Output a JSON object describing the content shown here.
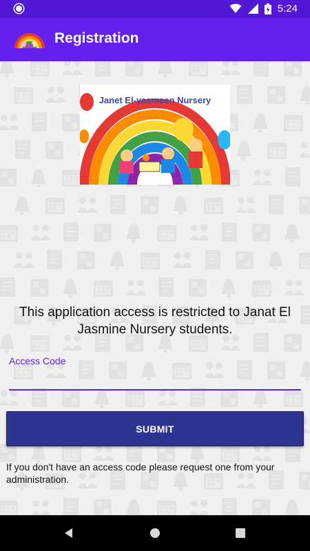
{
  "status_bar": {
    "time": "5:24",
    "icons": [
      "notification-dot-icon",
      "wifi-icon",
      "signal-icon",
      "battery-charging-icon"
    ]
  },
  "app_bar": {
    "title": "Registration",
    "logo_icon": "rainbow-logo-icon"
  },
  "hero": {
    "banner_text": "Janet El-yasmeen Nursery"
  },
  "message": "This application access is restricted to Janat El Jasmine Nursery students.",
  "access_code": {
    "label": "Access Code",
    "value": "",
    "placeholder": ""
  },
  "submit_label": "SUBMIT",
  "help_text": "If you don't have an access code please request one from your administration.",
  "nav_bar": {
    "buttons": [
      "back-icon",
      "home-icon",
      "recents-icon"
    ]
  },
  "colors": {
    "status_bar": "#5218d6",
    "app_bar": "#6320ee",
    "accent": "#5a22d8",
    "button": "#2d3590",
    "background": "#f0f0f0"
  }
}
